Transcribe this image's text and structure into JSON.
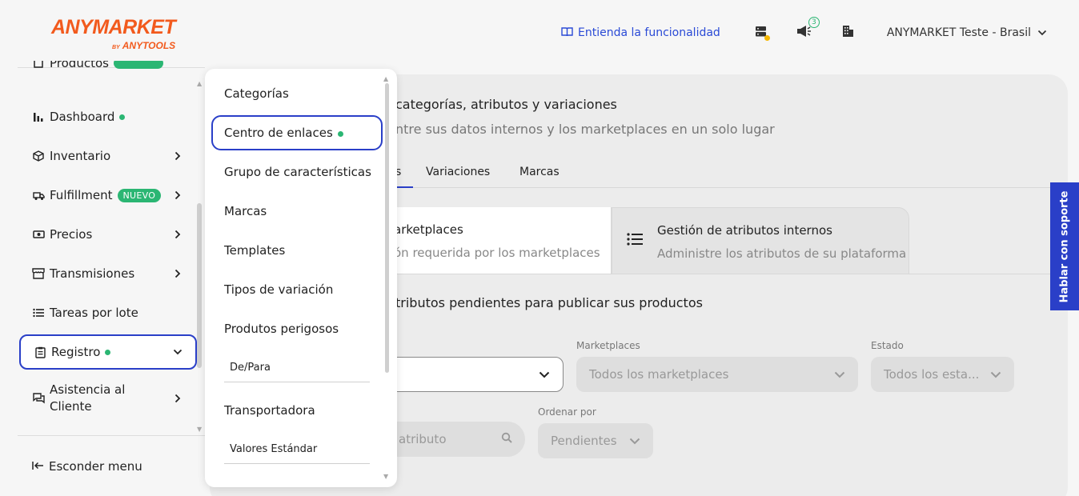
{
  "header": {
    "brand": "ANYMARKET",
    "brand_by_small": "BY",
    "brand_by": "ANYTOOLS",
    "help_link": "Entienda la funcionalidad",
    "notifications_count": "3",
    "store_name": "ANYMARKET Teste - Brasil"
  },
  "sidebar": {
    "partial_top": "Productos",
    "items": [
      {
        "label": "Dashboard"
      },
      {
        "label": "Inventario"
      },
      {
        "label": "Fulfillment",
        "badge": "NUEVO"
      },
      {
        "label": "Precios"
      },
      {
        "label": "Transmisiones"
      },
      {
        "label": "Tareas por lote"
      },
      {
        "label": "Registro"
      },
      {
        "label": "Asistencia al",
        "label2": "Cliente"
      }
    ],
    "hide_menu": "Esconder menu"
  },
  "popup": {
    "items": [
      "Categorías",
      "Centro de enlaces",
      "Grupo de características",
      "Marcas",
      "Templates",
      "Tipos de variación",
      "Produtos perigosos",
      "De/Para",
      "Transportadora",
      "Valores Estándar"
    ]
  },
  "main": {
    "title": "categorías, atributos y variaciones",
    "subtitle": "ntre sus datos internos y los marketplaces en un solo lugar",
    "tabs": [
      "s",
      "Variaciones",
      "Marcas"
    ],
    "card_a": {
      "title": "arketplaces",
      "subtitle": "ón requerida por los marketplaces"
    },
    "card_b": {
      "title": "Gestión de atributos internos",
      "subtitle": "Administre los atributos de su plataforma"
    },
    "pending_text": "tributos pendientes para publicar sus productos",
    "filters": {
      "marketplaces_label": "Marketplaces",
      "marketplaces_value": "Todos los marketplaces",
      "estado_label": "Estado",
      "estado_value": "Todos los esta...",
      "search_placeholder": "atributo",
      "order_label": "Ordenar por",
      "order_value": "Pendientes"
    }
  },
  "support_tab": "Hablar con soporte",
  "colors": {
    "accent": "#2a3fc8",
    "brand": "#f25a1d",
    "success": "#2bb673"
  }
}
